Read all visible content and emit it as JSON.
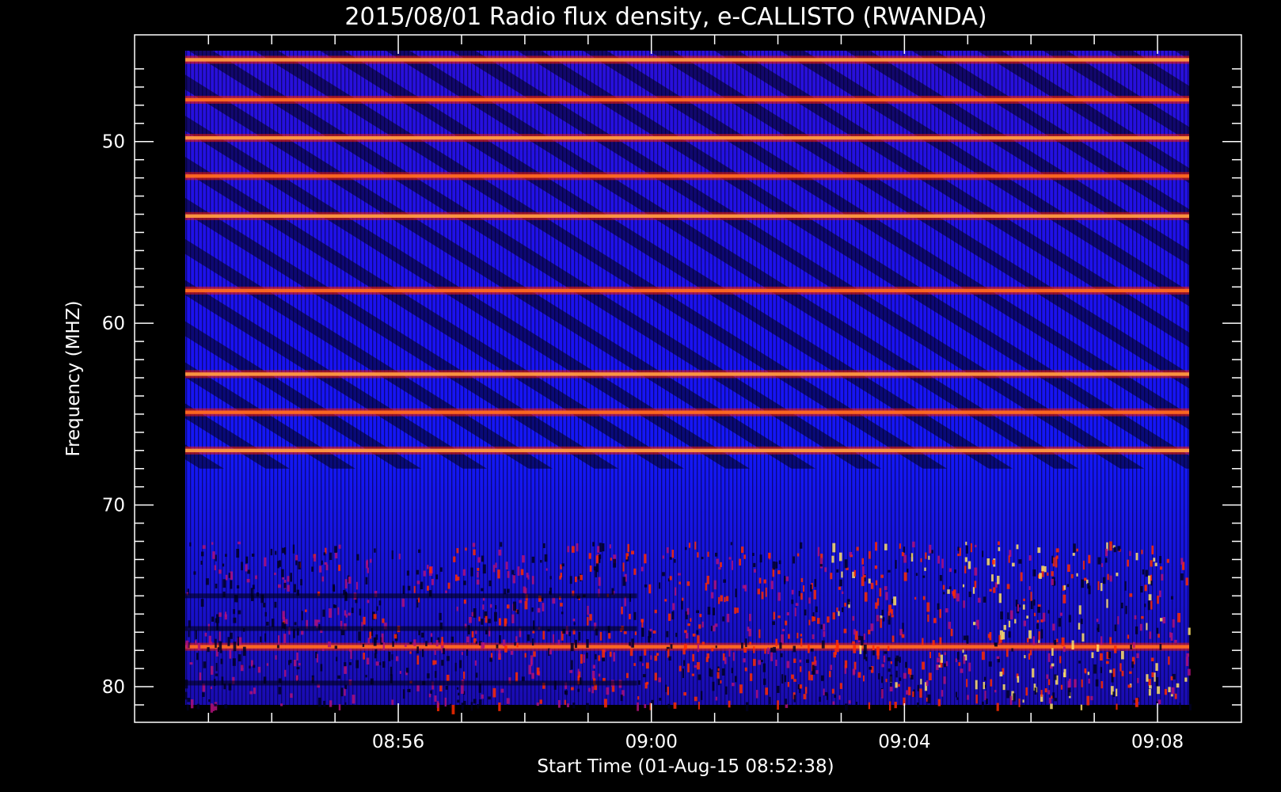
{
  "chart_data": {
    "type": "heatmap",
    "title": "2015/08/01  Radio flux density, e-CALLISTO (RWANDA)",
    "xlabel": "Start Time (01-Aug-15 08:52:38)",
    "ylabel": "Frequency (MHZ)",
    "x_range": [
      "08:52:38",
      "09:08:30"
    ],
    "y_range": [
      45,
      81
    ],
    "y_inverted": true,
    "x_ticks": [
      "08:56",
      "09:00",
      "09:04",
      "09:08"
    ],
    "y_ticks": [
      50,
      60,
      70,
      80
    ],
    "colormap": {
      "low": "#0000ff",
      "mid": "#ff1a00",
      "high": "#ffe066",
      "background": "#000000"
    },
    "horizontal_bands_mhz": [
      45.5,
      47.7,
      49.8,
      51.9,
      54.1,
      58.2,
      62.8,
      64.9,
      67.0,
      77.8
    ],
    "bursty_region_mhz": [
      72,
      81
    ],
    "grid": false,
    "legend": "none"
  }
}
